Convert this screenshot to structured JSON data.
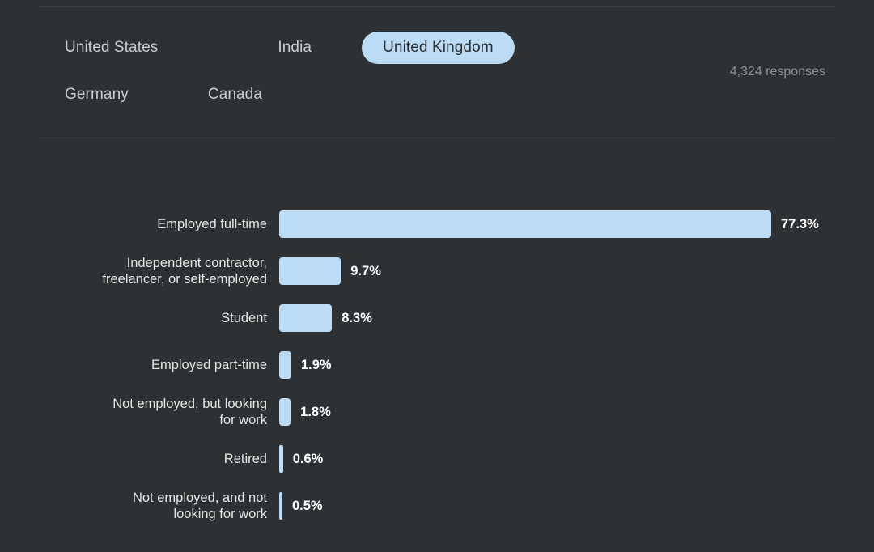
{
  "header": {
    "responses_label": "4,324 responses",
    "countries": [
      {
        "id": "united-states",
        "label": "United States",
        "active": false
      },
      {
        "id": "india",
        "label": "India",
        "active": false
      },
      {
        "id": "united-kingdom",
        "label": "United Kingdom",
        "active": true
      },
      {
        "id": "germany",
        "label": "Germany",
        "active": false
      },
      {
        "id": "canada",
        "label": "Canada",
        "active": false
      }
    ]
  },
  "colors": {
    "background": "#2d3134",
    "bar": "#bcdcf5",
    "active_pill_bg": "#bcdcf5",
    "active_pill_text": "#2b3034",
    "label_text": "#e6e7e4",
    "value_text": "#ffffff",
    "muted_text": "#8b9196",
    "divider": "#3b4045"
  },
  "chart_data": {
    "type": "bar",
    "orientation": "horizontal",
    "title": "",
    "subtitle": "",
    "xlabel": "",
    "ylabel": "",
    "grid": false,
    "legend": false,
    "xlim": [
      0,
      77.3
    ],
    "value_suffix": "%",
    "categories": [
      "Employed full-time",
      "Independent contractor,\nfreelancer, or self-employed",
      "Student",
      "Employed part-time",
      "Not employed, but looking\nfor work",
      "Retired",
      "Not employed, and not\nlooking for work"
    ],
    "values": [
      77.3,
      9.7,
      8.3,
      1.9,
      1.8,
      0.6,
      0.5
    ],
    "value_labels": [
      "77.3%",
      "9.7%",
      "8.3%",
      "1.9%",
      "1.8%",
      "0.6%",
      "0.5%"
    ]
  }
}
